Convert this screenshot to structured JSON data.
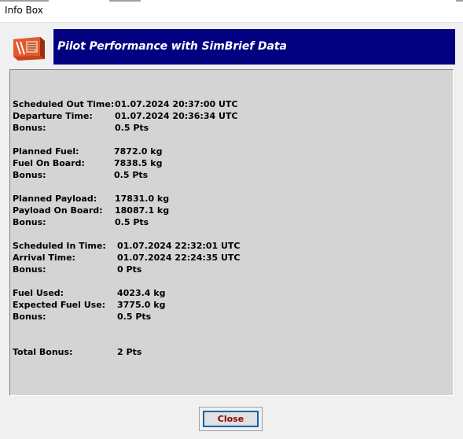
{
  "window": {
    "title": "Info Box"
  },
  "banner": {
    "title": "Pilot Performance with SimBrief Data",
    "background": "#000080"
  },
  "logo": {
    "icon": "flight-recorder-icon",
    "color": "#e0522a"
  },
  "groups": [
    {
      "rows": [
        {
          "label": "Scheduled Out Time:",
          "value": "01.07.2024 20:37:00 UTC"
        },
        {
          "label": "Departure Time:",
          "value": "01.07.2024 20:36:34 UTC"
        },
        {
          "label": "Bonus:",
          "value": "0.5 Pts"
        }
      ]
    },
    {
      "rows": [
        {
          "label": "Planned Fuel:",
          "value": "7872.0 kg"
        },
        {
          "label": "Fuel On Board:",
          "value": "7838.5 kg"
        },
        {
          "label": "Bonus:",
          "value": "0.5 Pts"
        }
      ]
    },
    {
      "rows": [
        {
          "label": "Planned Payload:",
          "value": "17831.0 kg"
        },
        {
          "label": "Payload On Board:",
          "value": "18087.1 kg"
        },
        {
          "label": "Bonus:",
          "value": "0.5 Pts"
        }
      ]
    },
    {
      "rows": [
        {
          "label": "Scheduled In Time:",
          "value": "01.07.2024 22:32:01 UTC"
        },
        {
          "label": "Arrival Time:",
          "value": "01.07.2024 22:24:35 UTC"
        },
        {
          "label": "Bonus:",
          "value": "0 Pts"
        }
      ]
    },
    {
      "rows": [
        {
          "label": "Fuel Used:",
          "value": "4023.4 kg"
        },
        {
          "label": "Expected Fuel Use:",
          "value": "3775.0 kg"
        },
        {
          "label": "Bonus:",
          "value": "0.5 Pts"
        }
      ]
    },
    {
      "rows": [
        {
          "label": "Total Bonus:",
          "value": "2 Pts"
        }
      ]
    }
  ],
  "buttons": {
    "close_label": "Close"
  }
}
